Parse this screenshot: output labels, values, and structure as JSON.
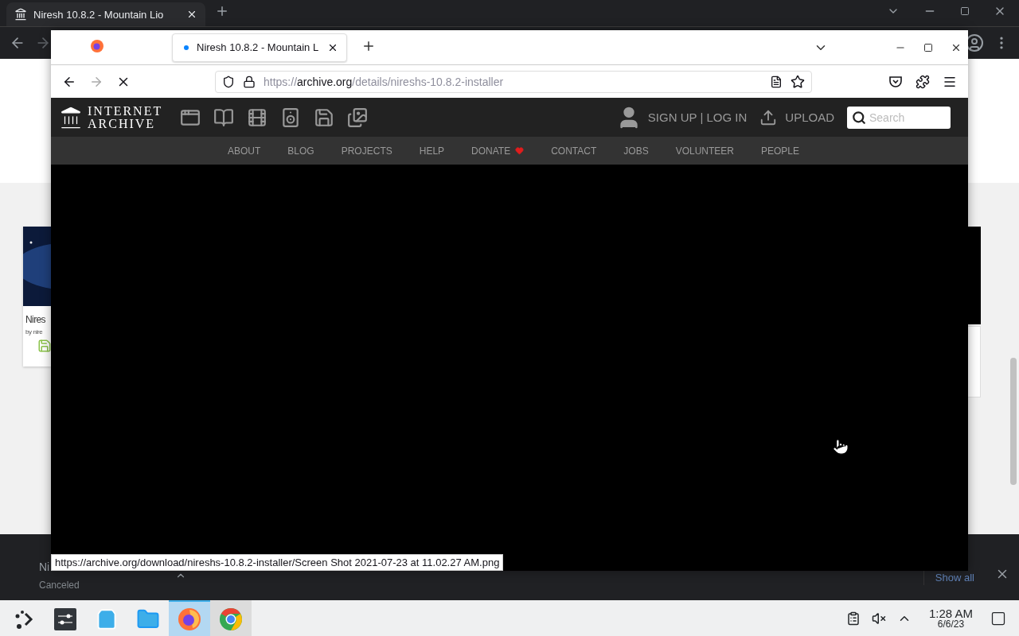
{
  "chrome": {
    "tab": {
      "title": "Niresh 10.8.2 - Mountain Lio"
    },
    "page": {
      "card": {
        "kind": "picture",
        "title": "Nires",
        "byline": "by nire"
      }
    },
    "downloads": {
      "item": {
        "name": "Ni",
        "status": "Canceled"
      },
      "show_all": "Show all"
    }
  },
  "firefox": {
    "tab": {
      "title": "Niresh 10.8.2 - Mountain L"
    },
    "loading": true,
    "url": {
      "scheme": "https://",
      "host": "archive.org",
      "path": "/details/nireshs-10.8.2-installer"
    },
    "site": {
      "logo": [
        "INTERNET",
        "ARCHIVE"
      ],
      "sign_up": "SIGN UP",
      "separator": "|",
      "log_in": "LOG IN",
      "upload": "UPLOAD",
      "search": {
        "placeholder": "Search"
      },
      "nav": [
        {
          "label": "ABOUT",
          "heart": false
        },
        {
          "label": "BLOG",
          "heart": false
        },
        {
          "label": "PROJECTS",
          "heart": false
        },
        {
          "label": "HELP",
          "heart": false
        },
        {
          "label": "DONATE",
          "heart": true
        },
        {
          "label": "CONTACT",
          "heart": false
        },
        {
          "label": "JOBS",
          "heart": false
        },
        {
          "label": "VOLUNTEER",
          "heart": false
        },
        {
          "label": "PEOPLE",
          "heart": false
        }
      ]
    },
    "status_url": "https://archive.org/download/nireshs-10.8.2-installer/Screen Shot 2021-07-23 at 11.02.27 AM.png"
  },
  "taskbar": {
    "apps": [
      {
        "kind": "launcher",
        "selected": false,
        "open": false
      },
      {
        "kind": "settings",
        "selected": false,
        "open": false
      },
      {
        "kind": "store",
        "selected": false,
        "open": false
      },
      {
        "kind": "files",
        "selected": false,
        "open": false
      },
      {
        "kind": "firefox",
        "selected": true,
        "open": true
      },
      {
        "kind": "chrome",
        "selected": false,
        "open": true
      }
    ],
    "clock": {
      "time": "1:28 AM",
      "date": "6/6/23"
    },
    "volume_muted": true
  }
}
